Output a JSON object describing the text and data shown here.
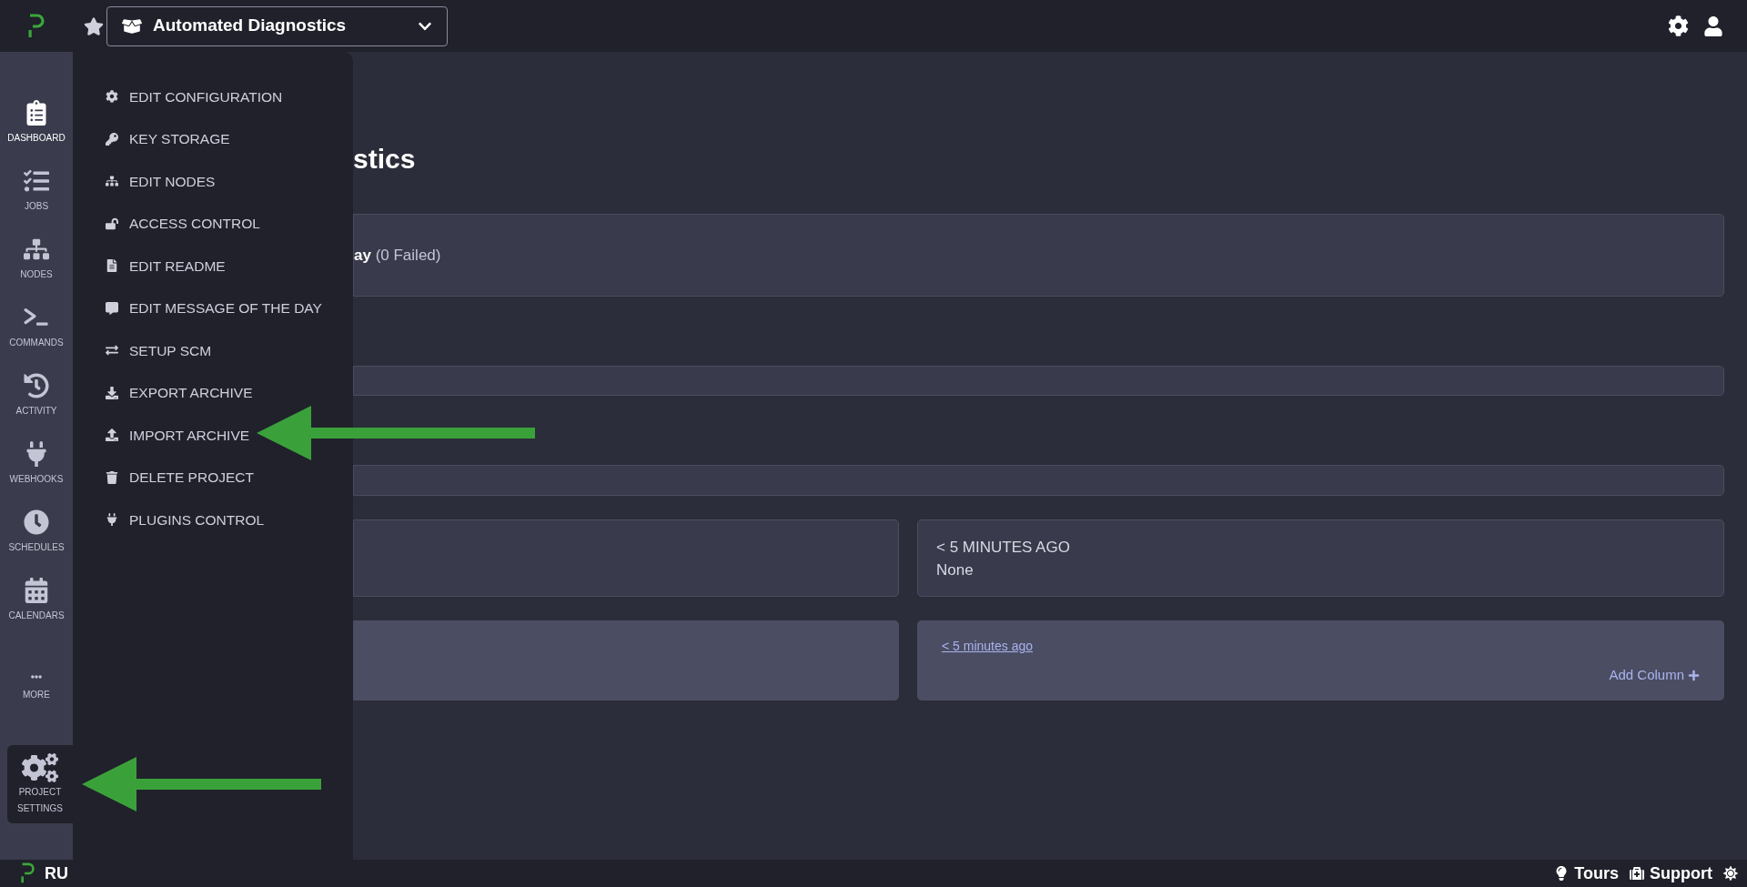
{
  "top_bar": {
    "starred": true,
    "project": "Automated Diagnostics"
  },
  "nav_items": [
    {
      "label": "DASHBOARD",
      "selected": true
    },
    {
      "label": "JOBS",
      "selected": false
    },
    {
      "label": "NODES",
      "selected": false
    },
    {
      "label": "COMMANDS",
      "selected": false
    },
    {
      "label": "ACTIVITY",
      "selected": false
    },
    {
      "label": "WEBHOOKS",
      "selected": false
    },
    {
      "label": "SCHEDULES",
      "selected": false
    },
    {
      "label": "CALENDARS",
      "selected": false
    },
    {
      "label": "MORE",
      "selected": false
    }
  ],
  "project_settings": {
    "label_lines": [
      "PROJECT",
      "SETTINGS"
    ],
    "expanded": true
  },
  "settings_menu": [
    "EDIT CONFIGURATION",
    "KEY STORAGE",
    "EDIT NODES",
    "ACCESS CONTROL",
    "EDIT README",
    "EDIT MESSAGE OF THE DAY",
    "SETUP SCM",
    "EXPORT ARCHIVE",
    "IMPORT ARCHIVE",
    "DELETE PROJECT",
    "PLUGINS CONTROL"
  ],
  "main": {
    "title": "stics",
    "summary": "**ay** (0 Failed)",
    "status_card": {
      "heading": "< 5 MINUTES AGO",
      "value": "None"
    },
    "activity_card": {
      "link": "< 5 minutes ago",
      "action": "Add Column"
    }
  },
  "footer": {
    "brand": "RU",
    "links": [
      "Tours",
      "Support"
    ]
  }
}
